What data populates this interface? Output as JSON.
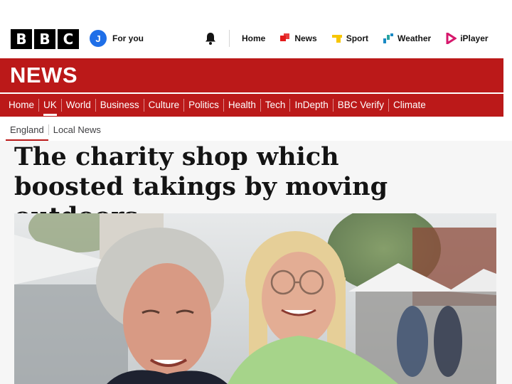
{
  "brand": {
    "letters": [
      "B",
      "B",
      "C"
    ]
  },
  "account": {
    "initial": "J",
    "label": "For you"
  },
  "icons": {
    "notifications": "bell-icon",
    "news": "news-icon",
    "sport": "sport-icon",
    "weather": "weather-icon",
    "iplayer": "iplayer-icon"
  },
  "topnav": [
    {
      "label": "Home"
    },
    {
      "label": "News"
    },
    {
      "label": "Sport"
    },
    {
      "label": "Weather"
    },
    {
      "label": "iPlayer"
    }
  ],
  "news": {
    "title": "NEWS"
  },
  "sections": [
    {
      "label": "Home"
    },
    {
      "label": "UK"
    },
    {
      "label": "World"
    },
    {
      "label": "Business"
    },
    {
      "label": "Culture"
    },
    {
      "label": "Politics"
    },
    {
      "label": "Health"
    },
    {
      "label": "Tech"
    },
    {
      "label": "InDepth"
    },
    {
      "label": "BBC Verify"
    },
    {
      "label": "Climate"
    }
  ],
  "active_section": "UK",
  "subnav": [
    {
      "label": "England"
    },
    {
      "label": "Local News"
    }
  ],
  "article": {
    "headline": "The charity shop which boosted takings by moving outdoors"
  },
  "colors": {
    "brand_red": "#bb1919",
    "account_blue": "#1f6fe8"
  }
}
